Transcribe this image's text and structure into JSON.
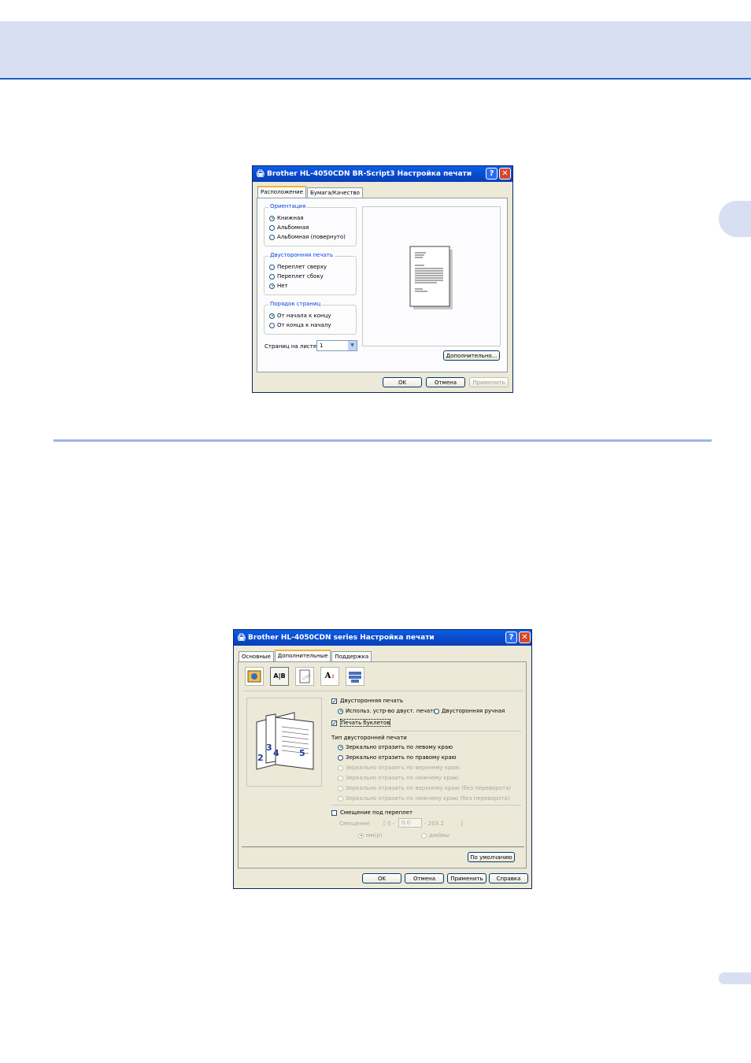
{
  "dialog1": {
    "title": "Brother HL-4050CDN BR-Script3 Настройка печати",
    "tabs": [
      "Расположение",
      "Бумага/Качество"
    ],
    "orientation": {
      "title": "Ориентация",
      "options": [
        "Книжная",
        "Альбомная",
        "Альбомная (повернуто)"
      ]
    },
    "duplex": {
      "title": "Двусторонняя печать",
      "options": [
        "Переплет сверху",
        "Переплет сбоку",
        "Нет"
      ]
    },
    "page_order": {
      "title": "Порядок страниц",
      "options": [
        "От начала к концу",
        "От конца к началу"
      ]
    },
    "pages_per_sheet_label": "Страниц на листе:",
    "pages_per_sheet_value": "1",
    "advanced_button": "Дополнительно...",
    "ok": "OK",
    "cancel": "Отмена",
    "apply": "Применить"
  },
  "dialog2": {
    "title": "Brother HL-4050CDN series Настройка печати",
    "tabs": [
      "Основные",
      "Дополнительные",
      "Поддержка"
    ],
    "duplex_checkbox": "Двусторонняя печать",
    "duplex_mode_device": "Использ. устр-во двуст. печати",
    "duplex_mode_manual": "Двусторонняя ручная",
    "booklet_checkbox": "Печать буклетов",
    "duplex_type_title": "Тип двусторонней печати",
    "duplex_types": [
      "Зеркально отразить по левому краю",
      "Зеркально отразить по правому краю",
      "Зеркально отразить по верхнему краю",
      "Зеркально отразить по нижнему краю",
      "Зеркально отразить по верхнему краю (без переворота)",
      "Зеркально отразить по нижнему краю (без переворота)"
    ],
    "binding_offset_checkbox": "Смещение под переплет",
    "offset_label": "Смещение",
    "offset_range_start": "[ 0 -",
    "offset_value": "0.0",
    "offset_range_end": "- 203.2",
    "offset_close_bracket": "]",
    "unit_mm": "мм(p)",
    "unit_inch": "дюймы",
    "default_button": "По умолчанию",
    "ok": "OK",
    "cancel": "Отмена",
    "apply": "Применить",
    "help": "Справка",
    "booklet_page_numbers": [
      "3",
      "4",
      "2",
      "5"
    ]
  }
}
